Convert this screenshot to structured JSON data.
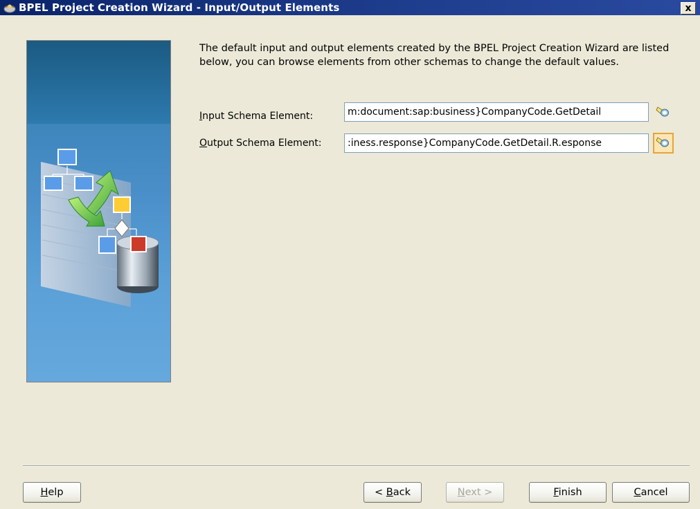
{
  "window": {
    "title": "BPEL Project Creation Wizard - Input/Output Elements",
    "close_label": "x"
  },
  "description": "The default input and output elements created by the BPEL Project Creation Wizard are listed below, you can browse elements from other schemas to change the default values.",
  "fields": {
    "input": {
      "label_mnemonic": "I",
      "label_rest": "nput Schema Element:",
      "value": "m:document:sap:business}CompanyCode.GetDetail",
      "browse_icon": "flashlight-icon"
    },
    "output": {
      "label_mnemonic": "O",
      "label_rest": "utput Schema Element:",
      "value": ":iness.response}CompanyCode.GetDetail.R.esponse",
      "browse_icon": "flashlight-icon"
    }
  },
  "buttons": {
    "help": {
      "mnemonic": "H",
      "rest": "elp",
      "enabled": true
    },
    "back": {
      "prefix": "< ",
      "mnemonic": "B",
      "rest": "ack",
      "enabled": true
    },
    "next": {
      "mnemonic": "N",
      "rest": "ext >",
      "enabled": false
    },
    "finish": {
      "mnemonic": "F",
      "rest": "inish",
      "enabled": true
    },
    "cancel": {
      "mnemonic": "C",
      "rest": "ancel",
      "enabled": true
    }
  },
  "colors": {
    "titlebar": "#0a246a",
    "dialog_bg": "#ece9d8",
    "panel_accent": "#4a8fc9"
  }
}
